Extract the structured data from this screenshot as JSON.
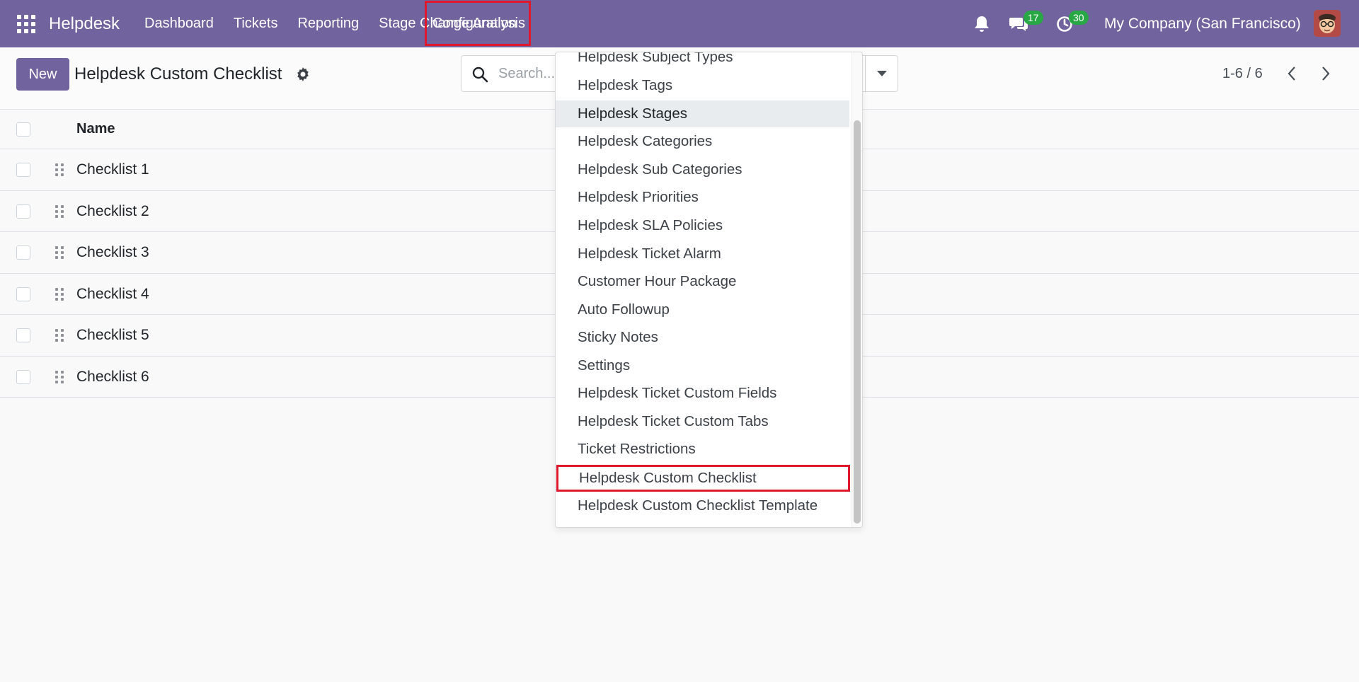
{
  "navbar": {
    "apps_icon": "apps-grid-icon",
    "brand": "Helpdesk",
    "menu": [
      "Dashboard",
      "Tickets",
      "Reporting",
      "Stage Change Analysis"
    ],
    "config_label": "Configuration",
    "messages_count": "17",
    "activities_count": "30",
    "company": "My Company (San Francisco)"
  },
  "control": {
    "new_label": "New",
    "title": "Helpdesk Custom Checklist",
    "search_placeholder": "Search...",
    "pager": "1-6 / 6"
  },
  "list": {
    "column_name": "Name",
    "rows": [
      "Checklist 1",
      "Checklist 2",
      "Checklist 3",
      "Checklist 4",
      "Checklist 5",
      "Checklist 6"
    ]
  },
  "dropdown": {
    "items": [
      "Helpdesk Subject Types",
      "Helpdesk Tags",
      "Helpdesk Stages",
      "Helpdesk Categories",
      "Helpdesk Sub Categories",
      "Helpdesk Priorities",
      "Helpdesk SLA Policies",
      "Helpdesk Ticket Alarm",
      "Customer Hour Package",
      "Auto Followup",
      "Sticky Notes",
      "Settings",
      "Helpdesk Ticket Custom Fields",
      "Helpdesk Ticket Custom Tabs",
      "Ticket Restrictions",
      "Helpdesk Custom Checklist",
      "Helpdesk Custom Checklist Template"
    ],
    "hovered": "Helpdesk Stages",
    "highlighted": "Helpdesk Custom Checklist"
  },
  "colors": {
    "brand": "#71639e",
    "highlight_border": "#e0182b",
    "badge": "#28a745"
  }
}
